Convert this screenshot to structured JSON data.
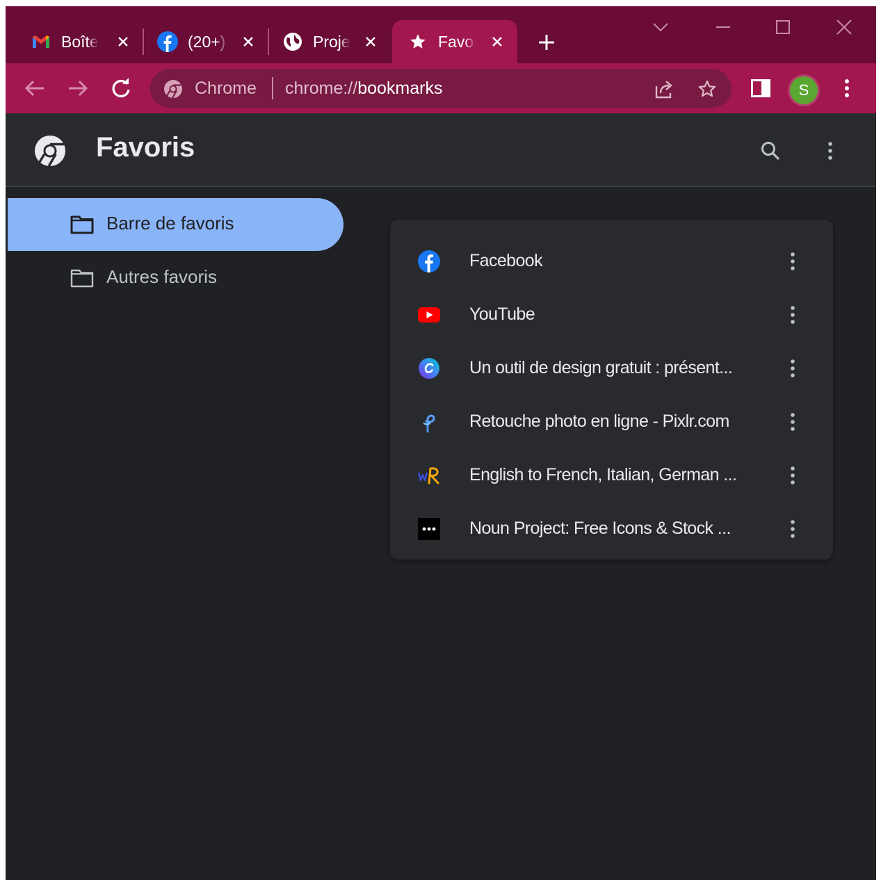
{
  "tabs": [
    {
      "title": "Boîte",
      "icon": "gmail-icon",
      "active": false
    },
    {
      "title": "(20+)",
      "icon": "facebook-icon",
      "active": false
    },
    {
      "title": "Projet",
      "icon": "globe-icon",
      "active": false
    },
    {
      "title": "Favoris",
      "icon": "star-icon",
      "active": true
    }
  ],
  "omnibox": {
    "chip_label": "Chrome",
    "url_scheme": "chrome://",
    "url_host": "bookmarks"
  },
  "profile": {
    "initial": "S",
    "color": "#5aa832"
  },
  "page": {
    "title": "Favoris"
  },
  "sidebar": {
    "items": [
      {
        "label": "Barre de favoris",
        "selected": true
      },
      {
        "label": "Autres favoris",
        "selected": false
      }
    ]
  },
  "bookmarks": [
    {
      "title": "Facebook",
      "icon": "facebook-icon"
    },
    {
      "title": "YouTube",
      "icon": "youtube-icon"
    },
    {
      "title": "Un outil de design gratuit : présent...",
      "icon": "canva-icon"
    },
    {
      "title": "Retouche photo en ligne - Pixlr.com",
      "icon": "pixlr-icon"
    },
    {
      "title": "English to French, Italian, German ...",
      "icon": "wordreference-icon"
    },
    {
      "title": "Noun Project: Free Icons & Stock ...",
      "icon": "noun-project-icon"
    }
  ],
  "colors": {
    "tabstrip": "#6a0c36",
    "toolbar": "#a3174f",
    "page_bg": "#202124",
    "selected": "#8ab4f8"
  }
}
